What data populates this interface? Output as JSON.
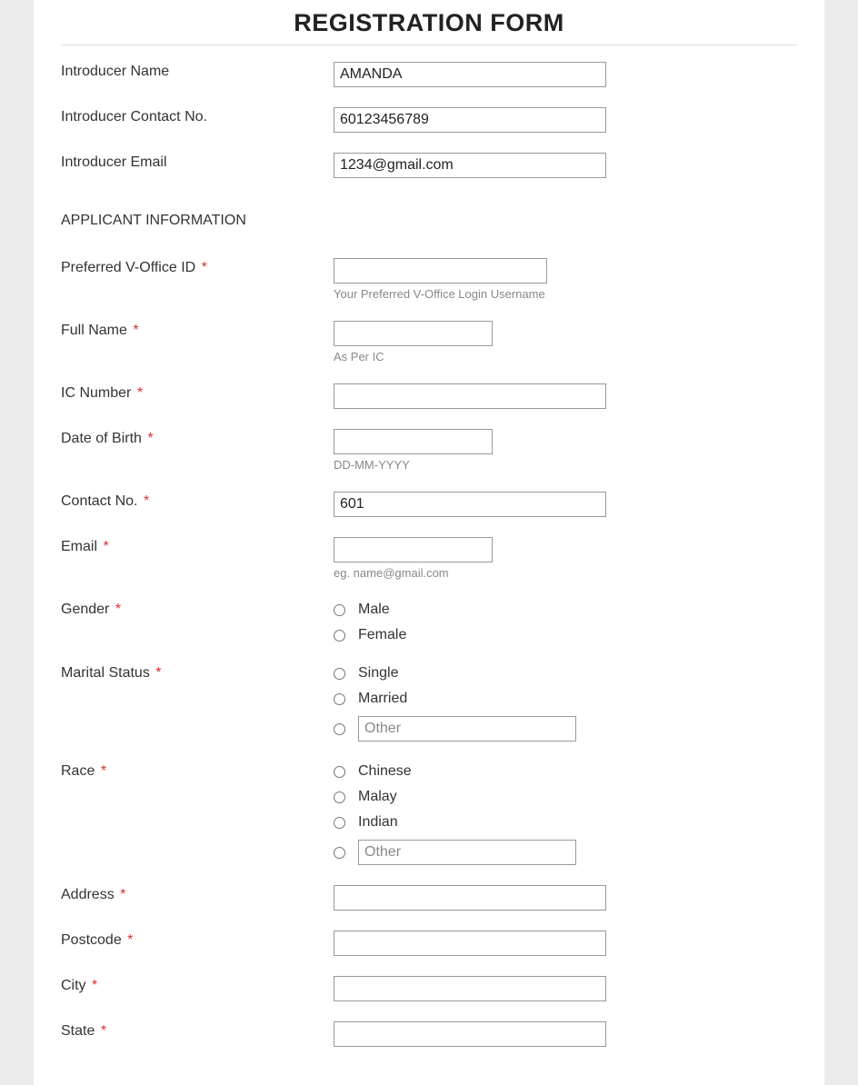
{
  "title": "REGISTRATION FORM",
  "introducer": {
    "name_label": "Introducer Name",
    "name_value": "AMANDA",
    "contact_label": "Introducer Contact No.",
    "contact_value": "60123456789",
    "email_label": "Introducer Email",
    "email_value": "1234@gmail.com"
  },
  "section_applicant": "APPLICANT INFORMATION",
  "applicant": {
    "voffice_label": "Preferred V-Office ID",
    "voffice_helper": "Your Preferred V-Office Login Username",
    "fullname_label": "Full Name",
    "fullname_helper": "As Per IC",
    "ic_label": "IC Number",
    "dob_label": "Date of Birth",
    "dob_helper": "DD-MM-YYYY",
    "contact_label": "Contact No.",
    "contact_value": "601",
    "email_label": "Email",
    "email_helper": "eg. name@gmail.com",
    "gender_label": "Gender",
    "gender_options": {
      "male": "Male",
      "female": "Female"
    },
    "marital_label": "Marital Status",
    "marital_options": {
      "single": "Single",
      "married": "Married",
      "other_placeholder": "Other"
    },
    "race_label": "Race",
    "race_options": {
      "chinese": "Chinese",
      "malay": "Malay",
      "indian": "Indian",
      "other_placeholder": "Other"
    },
    "address_label": "Address",
    "postcode_label": "Postcode",
    "city_label": "City",
    "state_label": "State"
  },
  "required_marker": "*"
}
